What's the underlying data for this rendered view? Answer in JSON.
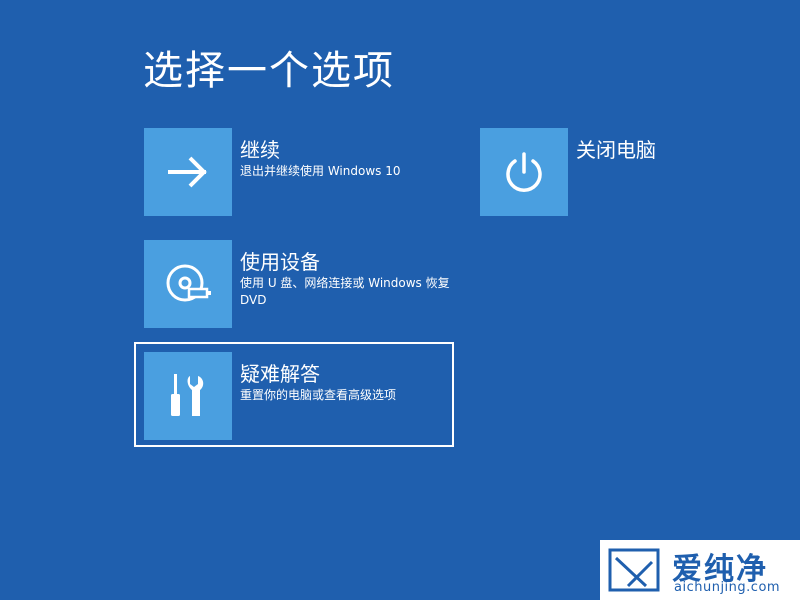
{
  "page": {
    "title": "选择一个选项"
  },
  "options": {
    "continue": {
      "label": "继续",
      "description": "退出并继续使用 Windows 10",
      "icon": "arrow-right-icon"
    },
    "use_device": {
      "label": "使用设备",
      "description": "使用 U 盘、网络连接或 Windows 恢复 DVD",
      "icon": "disc-usb-icon"
    },
    "troubleshoot": {
      "label": "疑难解答",
      "description": "重置你的电脑或查看高级选项",
      "icon": "tools-icon",
      "focused": true
    },
    "shutdown": {
      "label": "关闭电脑",
      "icon": "power-icon"
    }
  },
  "watermark": {
    "brand": "爱纯净",
    "site": "aichunjing.com"
  },
  "colors": {
    "background": "#1f5fae",
    "tile": "#4a9fe0",
    "text": "#ffffff",
    "focus_border": "#ffffff"
  }
}
